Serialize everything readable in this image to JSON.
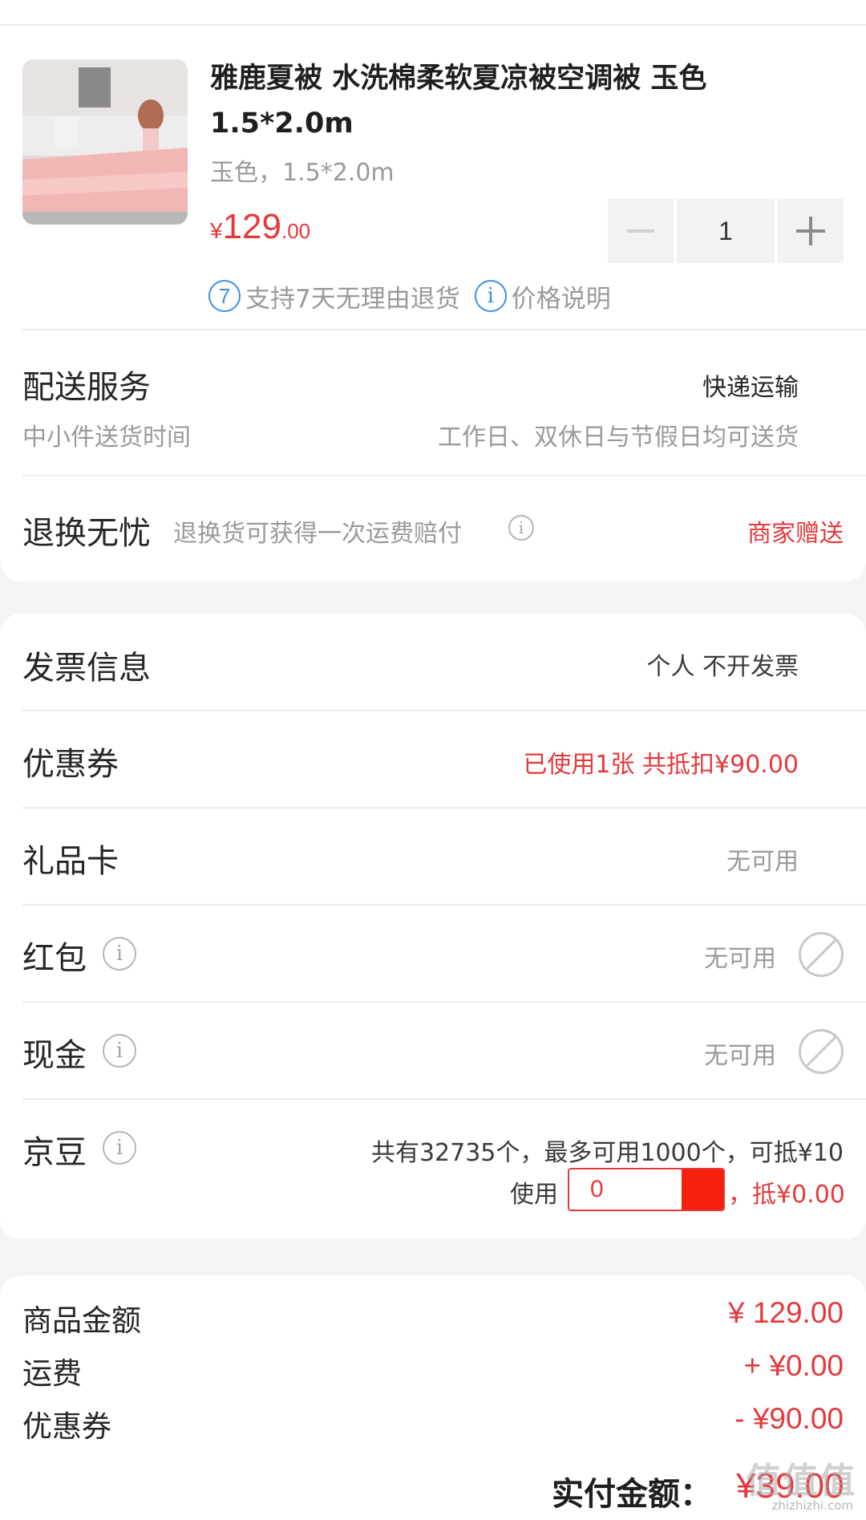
{
  "product": {
    "title": "雅鹿夏被 水洗棉柔软夏凉被空调被 玉色 1.5*2.0m",
    "spec": "玉色，1.5*2.0m",
    "price_currency": "¥",
    "price_int": "129",
    "price_dec": ".00",
    "quantity": "1",
    "minus_symbol": "−",
    "plus_symbol": "+",
    "return_badge": "7",
    "return_text": "支持7天无理由退货",
    "info_badge": "i",
    "price_note": "价格说明"
  },
  "delivery": {
    "label": "配送服务",
    "value": "快递运输",
    "sub_label": "中小件送货时间",
    "sub_value": "工作日、双休日与节假日均可送货"
  },
  "return_worry_free": {
    "label": "退换无忧",
    "desc": "退换货可获得一次运费赔付",
    "value": "商家赠送"
  },
  "invoice": {
    "label": "发票信息",
    "value": "个人 不开发票"
  },
  "coupon": {
    "label": "优惠券",
    "value": "已使用1张 共抵扣¥90.00"
  },
  "gift_card": {
    "label": "礼品卡",
    "value": "无可用"
  },
  "red_packet": {
    "label": "红包",
    "value": "无可用"
  },
  "cash": {
    "label": "现金",
    "value": "无可用"
  },
  "jd_beans": {
    "label": "京豆",
    "desc": "共有32735个，最多可用1000个，可抵¥10",
    "use_label": "使用",
    "input_value": "0",
    "deduct": "，抵¥0.00"
  },
  "summary": {
    "goods_label": "商品金额",
    "goods_value": "¥ 129.00",
    "shipping_label": "运费",
    "shipping_value": "+ ¥0.00",
    "coupon_label": "优惠券",
    "coupon_value": "- ¥90.00",
    "pay_label": "实付金额：",
    "pay_value": "¥39.00"
  },
  "watermark": {
    "text": "值值值",
    "sub": "zhizhizhi.com"
  },
  "icons": {
    "info": "info-icon",
    "ban": "ban-icon"
  },
  "colors": {
    "accent": "#e4393c",
    "blue": "#3b8fe8",
    "grey_text": "#9a9a9a",
    "background": "#f4f4f4"
  }
}
